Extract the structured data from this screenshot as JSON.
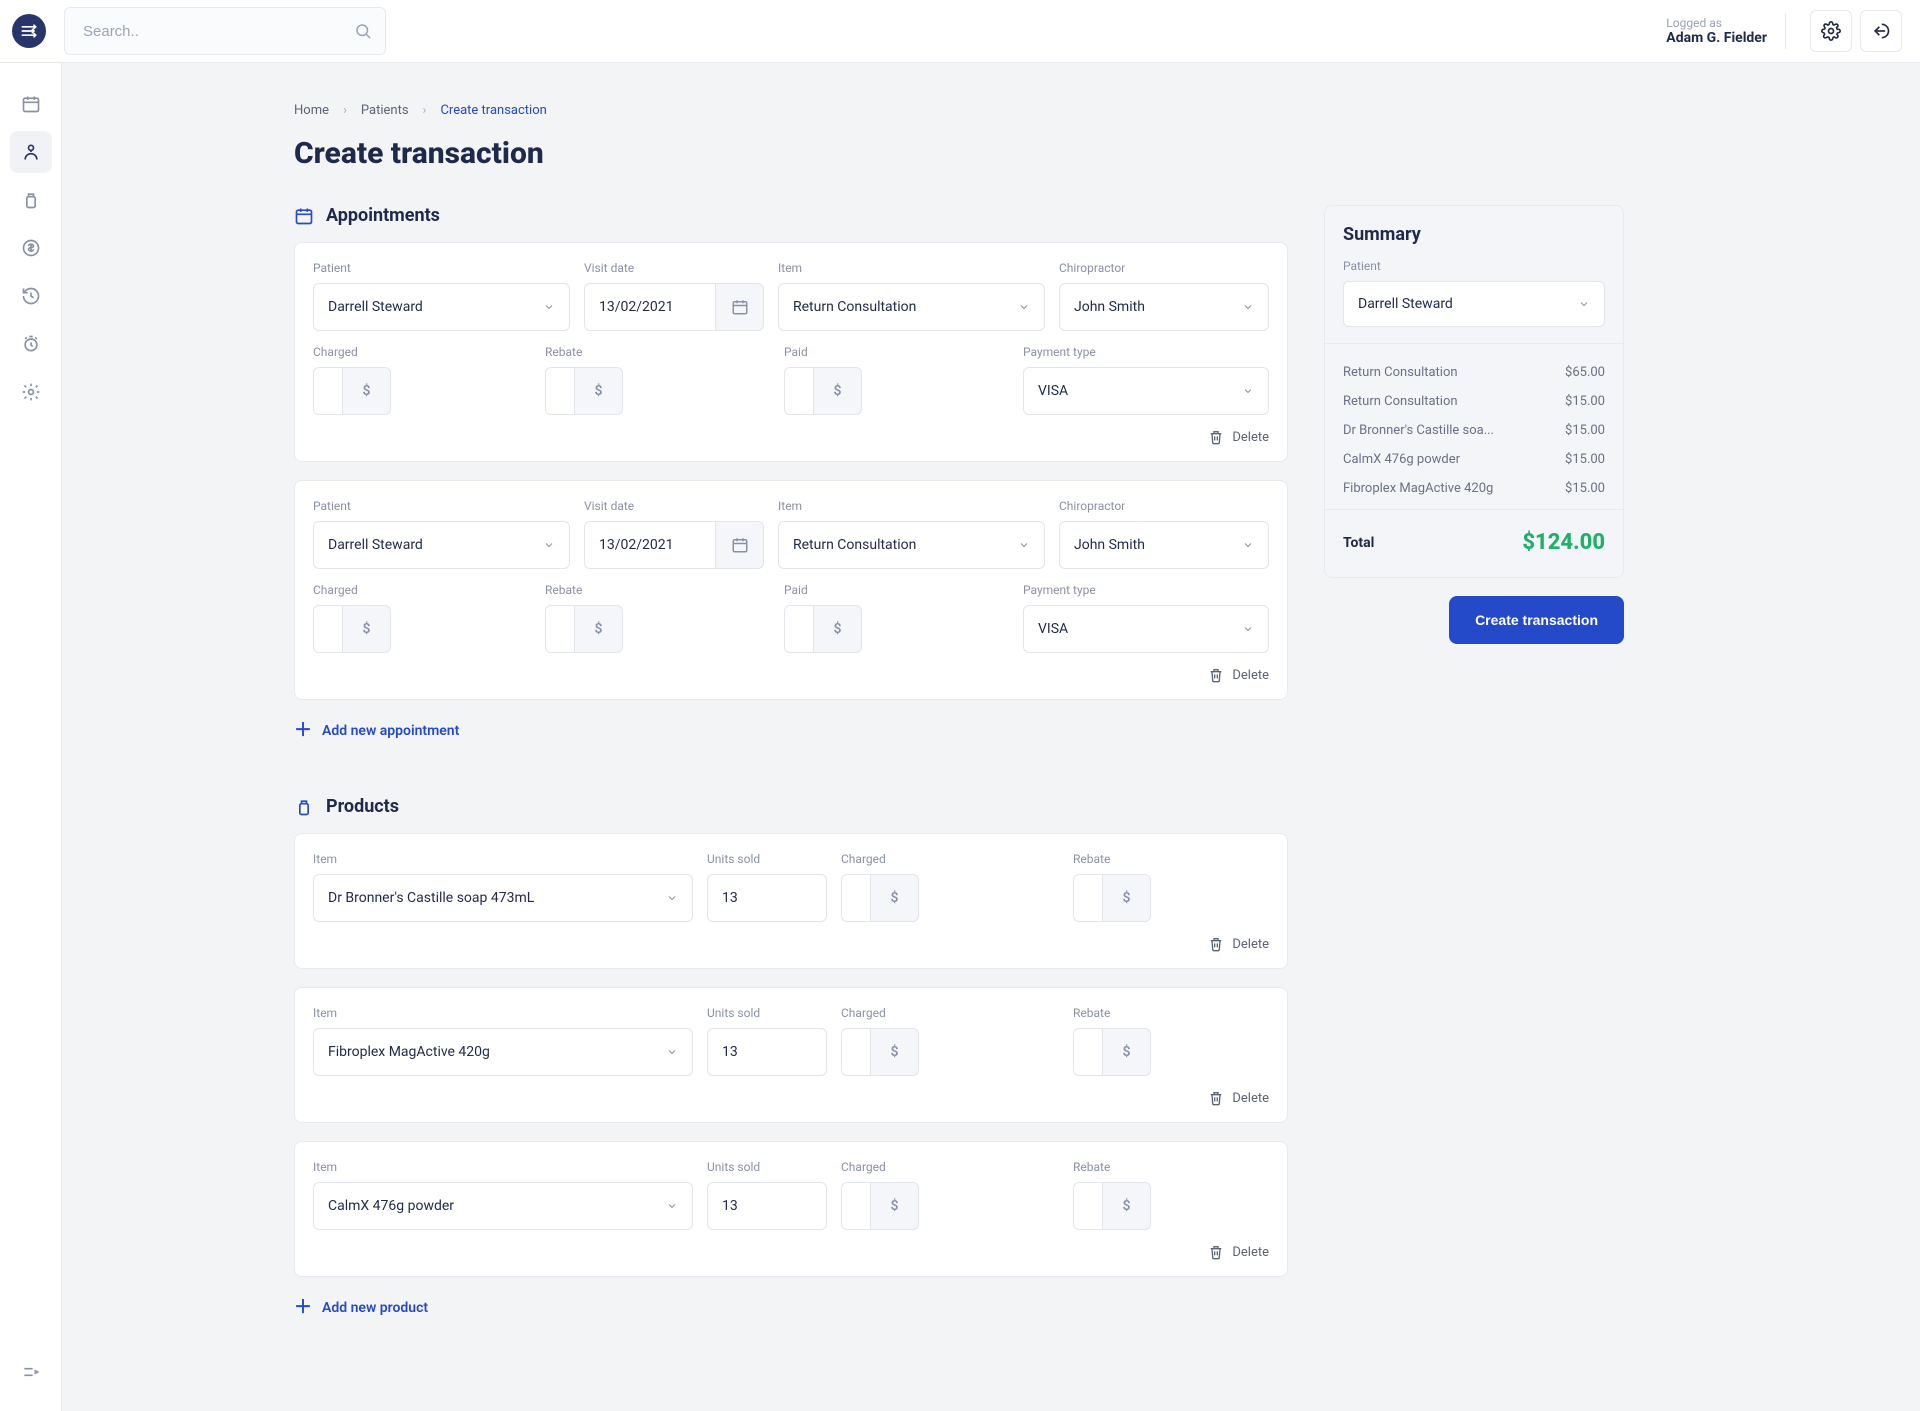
{
  "header": {
    "search_placeholder": "Search..",
    "logged_label": "Logged as",
    "logged_name": "Adam G. Fielder"
  },
  "breadcrumb": {
    "home": "Home",
    "patients": "Patients",
    "current": "Create transaction"
  },
  "page_title": "Create transaction",
  "sections": {
    "appointments_title": "Appointments",
    "products_title": "Products"
  },
  "labels": {
    "patient": "Patient",
    "visit_date": "Visit date",
    "item": "Item",
    "chiropractor": "Chiropractor",
    "charged": "Charged",
    "rebate": "Rebate",
    "paid": "Paid",
    "payment_type": "Payment type",
    "units_sold": "Units sold",
    "delete": "Delete",
    "dollar": "$"
  },
  "appointments": [
    {
      "patient": "Darrell Steward",
      "visit_date": "13/02/2021",
      "item": "Return Consultation",
      "chiropractor": "John Smith",
      "charged": "",
      "rebate": "",
      "paid": "",
      "payment_type": "VISA"
    },
    {
      "patient": "Darrell Steward",
      "visit_date": "13/02/2021",
      "item": "Return Consultation",
      "chiropractor": "John Smith",
      "charged": "",
      "rebate": "",
      "paid": "",
      "payment_type": "VISA"
    }
  ],
  "add_appointment": "Add new appointment",
  "products": [
    {
      "item": "Dr Bronner's Castille soap 473mL",
      "units": "13",
      "charged": "",
      "rebate": ""
    },
    {
      "item": "Fibroplex MagActive 420g",
      "units": "13",
      "charged": "",
      "rebate": ""
    },
    {
      "item": "CalmX 476g powder",
      "units": "13",
      "charged": "",
      "rebate": ""
    }
  ],
  "add_product": "Add new product",
  "summary": {
    "title": "Summary",
    "patient_label": "Patient",
    "patient": "Darrell Steward",
    "items": [
      {
        "name": "Return Consultation",
        "price": "$65.00"
      },
      {
        "name": "Return Consultation",
        "price": "$15.00"
      },
      {
        "name": "Dr Bronner's Castille soa...",
        "price": "$15.00"
      },
      {
        "name": "CalmX 476g powder",
        "price": "$15.00"
      },
      {
        "name": "Fibroplex MagActive 420g",
        "price": "$15.00"
      }
    ],
    "total_label": "Total",
    "total_value": "$124.00",
    "cta": "Create transaction"
  }
}
